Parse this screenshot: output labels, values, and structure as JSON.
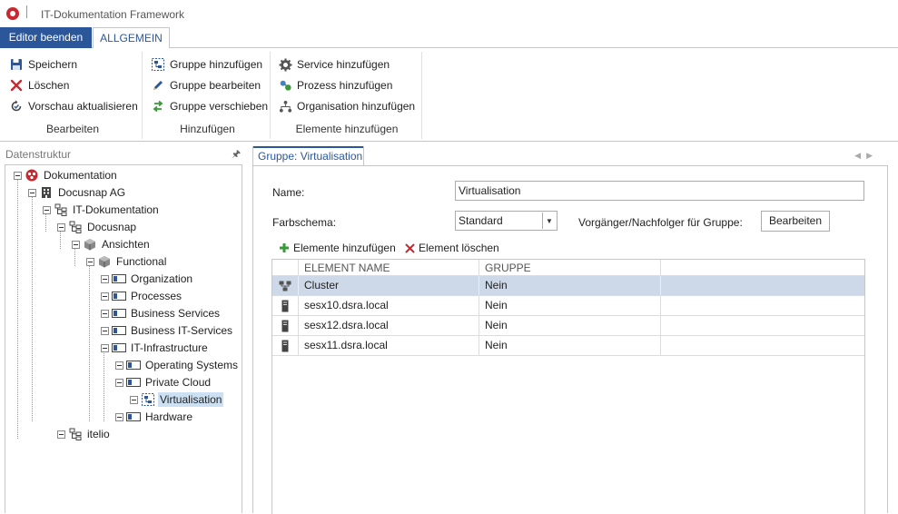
{
  "window": {
    "title": "IT-Dokumentation Framework"
  },
  "tabs": {
    "editor_exit": "Editor beenden",
    "general": "ALLGEMEIN"
  },
  "ribbon": {
    "groups": [
      {
        "label": "Bearbeiten",
        "items": [
          {
            "label": "Speichern",
            "icon": "save-icon"
          },
          {
            "label": "Löschen",
            "icon": "delete-icon"
          },
          {
            "label": "Vorschau aktualisieren",
            "icon": "refresh-icon"
          }
        ]
      },
      {
        "label": "Hinzufügen",
        "items": [
          {
            "label": "Gruppe hinzufügen",
            "icon": "add-group-icon"
          },
          {
            "label": "Gruppe bearbeiten",
            "icon": "edit-icon"
          },
          {
            "label": "Gruppe verschieben",
            "icon": "move-icon"
          }
        ]
      },
      {
        "label": "Elemente hinzufügen",
        "items": [
          {
            "label": "Service hinzufügen",
            "icon": "gear-icon"
          },
          {
            "label": "Prozess hinzufügen",
            "icon": "process-icon"
          },
          {
            "label": "Organisation hinzufügen",
            "icon": "organization-icon"
          }
        ]
      }
    ]
  },
  "left_panel": {
    "title": "Datenstruktur",
    "pin_icon": "pin-icon",
    "tree": [
      {
        "label": "Dokumentation",
        "icon": "docusnap-logo-icon"
      },
      {
        "label": "Docusnap AG",
        "icon": "building-icon"
      },
      {
        "label": "IT-Dokumentation",
        "icon": "hierarchy-icon"
      },
      {
        "label": "Docusnap",
        "icon": "hierarchy-icon"
      },
      {
        "label": "Ansichten",
        "icon": "cube-icon"
      },
      {
        "label": "Functional",
        "icon": "cube-icon"
      },
      {
        "label": "Organization",
        "icon": "group-box-icon"
      },
      {
        "label": "Processes",
        "icon": "group-box-icon"
      },
      {
        "label": "Business Services",
        "icon": "group-box-icon"
      },
      {
        "label": "Business IT-Services",
        "icon": "group-box-icon"
      },
      {
        "label": "IT-Infrastructure",
        "icon": "group-box-icon"
      },
      {
        "label": "Operating Systems",
        "icon": "group-box-icon"
      },
      {
        "label": "Private Cloud",
        "icon": "group-box-icon"
      },
      {
        "label": "Virtualisation",
        "icon": "group-dashed-icon"
      },
      {
        "label": "Hardware",
        "icon": "group-box-icon"
      },
      {
        "label": "itelio",
        "icon": "hierarchy-icon"
      }
    ]
  },
  "editor": {
    "tab_label": "Gruppe: Virtualisation",
    "name_label": "Name:",
    "name_value": "Virtualisation",
    "color_label": "Farbschema:",
    "color_value": "Standard",
    "pred_label": "Vorgänger/Nachfolger für Gruppe:",
    "edit_button": "Bearbeiten",
    "add_elements": "Elemente hinzufügen",
    "delete_element": "Element löschen",
    "columns": [
      "ELEMENT NAME",
      "GRUPPE"
    ],
    "rows": [
      {
        "name": "Cluster",
        "group": "Nein",
        "icon": "cluster-icon"
      },
      {
        "name": "sesx10.dsra.local",
        "group": "Nein",
        "icon": "server-icon"
      },
      {
        "name": "sesx12.dsra.local",
        "group": "Nein",
        "icon": "server-icon"
      },
      {
        "name": "sesx11.dsra.local",
        "group": "Nein",
        "icon": "server-icon"
      }
    ]
  },
  "colors": {
    "accent": "#2b579a",
    "selection": "#cdd9e8",
    "brand_red": "#c8282e"
  }
}
